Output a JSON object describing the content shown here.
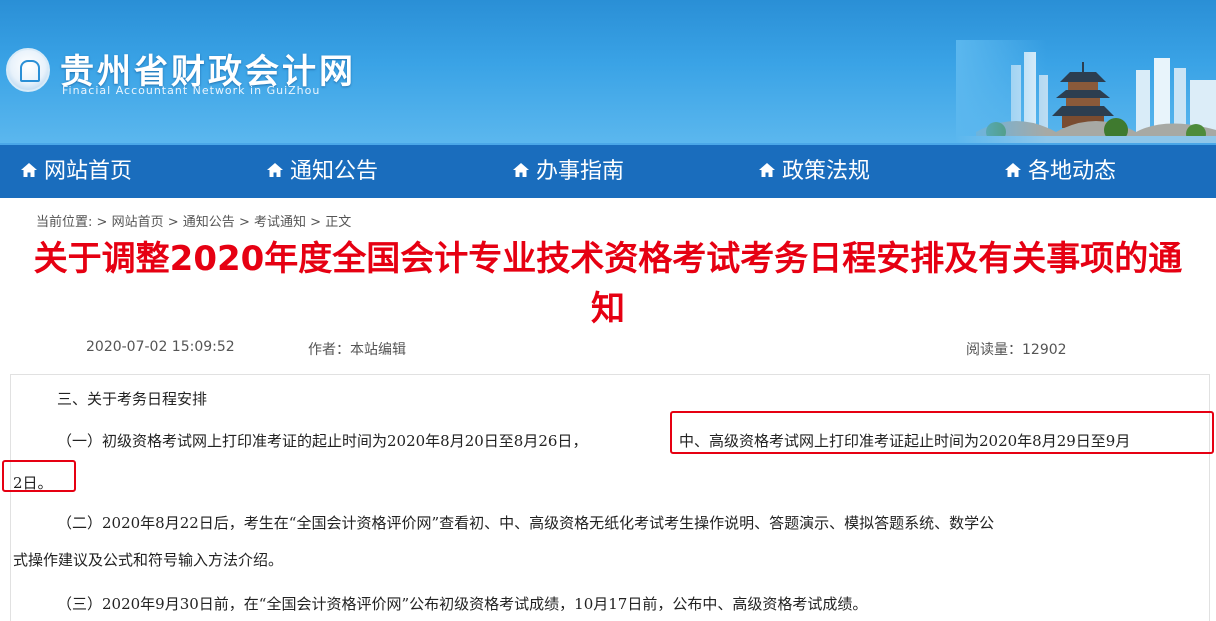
{
  "header": {
    "title": "贵州省财政会计网",
    "subtitle": "Finacial  Accountant Network in GuiZhou"
  },
  "nav": {
    "items": [
      {
        "label": "网站首页"
      },
      {
        "label": "通知公告"
      },
      {
        "label": "办事指南"
      },
      {
        "label": "政策法规"
      },
      {
        "label": "各地动态"
      }
    ]
  },
  "breadcrumb": {
    "prefix": "当前位置:",
    "sep": ">",
    "items": [
      "网站首页",
      "通知公告",
      "考试通知",
      "正文"
    ]
  },
  "article": {
    "title_line1": "关于调整2020年度全国会计专业技术资格考试考务日程安排及有关事项的通",
    "title_line2": "知",
    "date": "2020-07-02 15:09:52",
    "author": "作者：本站编辑",
    "views": "阅读量：12902"
  },
  "content": {
    "section_heading": "三、关于考务日程安排",
    "p1_a": "（一）初级资格考试网上打印准考证的起止时间为2020年8月20日至8月26日，",
    "p1_b": "中、高级资格考试网上打印准考证起止时间为2020年8月29日至9月",
    "p1_c": "2日。",
    "p2_a": "（二）2020年8月22日后，考生在“全国会计资格评价网”查看初、中、高级资格无纸化考试考生操作说明、答题演示、模拟答题系统、数学公",
    "p2_b": "式操作建议及公式和符号输入方法介绍。",
    "p3": "（三）2020年9月30日前，在“全国会计资格评价网”公布初级资格考试成绩，10月17日前，公布中、高级资格考试成绩。"
  },
  "colors": {
    "banner": "#2a8fd6",
    "nav": "#1a6dbd",
    "title_red": "#e60012",
    "highlight_red": "#e60012"
  }
}
